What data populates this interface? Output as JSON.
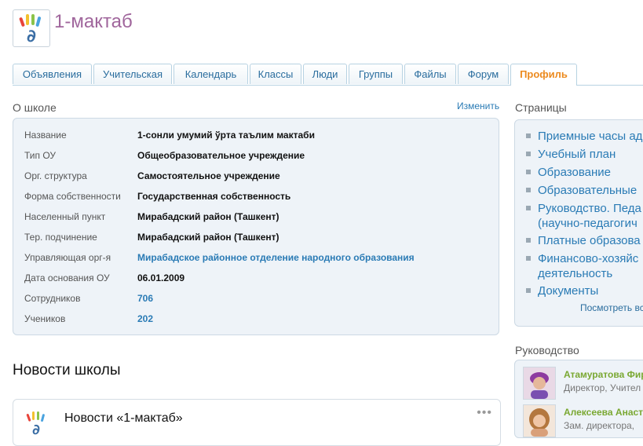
{
  "header": {
    "title": "1-мактаб",
    "logo": "hand-logo"
  },
  "tabs": [
    {
      "label": "Объявления"
    },
    {
      "label": "Учительская"
    },
    {
      "label": "Календарь"
    },
    {
      "label": "Классы"
    },
    {
      "label": "Люди"
    },
    {
      "label": "Группы"
    },
    {
      "label": "Файлы"
    },
    {
      "label": "Форум"
    },
    {
      "label": "Профиль",
      "active": true
    }
  ],
  "about": {
    "heading": "О школе",
    "edit_label": "Изменить",
    "rows": [
      {
        "key": "Название",
        "value": "1-сонли умумий ўрта таълим мактаби"
      },
      {
        "key": "Тип ОУ",
        "value": "Общеобразовательное учреждение"
      },
      {
        "key": "Орг. структура",
        "value": "Самостоятельное учреждение"
      },
      {
        "key": "Форма собственности",
        "value": "Государственная собственность"
      },
      {
        "key": "Населенный пункт",
        "value": "Мирабадский район (Ташкент)"
      },
      {
        "key": "Тер. подчинение",
        "value": "Мирабадский район (Ташкент)"
      },
      {
        "key": "Управляющая орг-я",
        "value": "Мирабадское районное отделение народного образования",
        "link": true
      },
      {
        "key": "Дата основания ОУ",
        "value": "06.01.2009"
      },
      {
        "key": "Сотрудников",
        "value": "706",
        "link": true
      },
      {
        "key": "Учеников",
        "value": "202",
        "link": true
      }
    ]
  },
  "news": {
    "heading": "Новости школы",
    "card_title": "Новости «1-мактаб»",
    "menu_icon": "more-dots-icon"
  },
  "pages": {
    "heading": "Страницы",
    "items": [
      {
        "lines": [
          "Приемные часы ад"
        ]
      },
      {
        "lines": [
          "Учебный план"
        ]
      },
      {
        "lines": [
          "Образование"
        ]
      },
      {
        "lines": [
          "Образовательные"
        ]
      },
      {
        "lines": [
          "Руководство. Педа",
          "(научно-педагогич"
        ]
      },
      {
        "lines": [
          "Платные образова"
        ]
      },
      {
        "lines": [
          "Финансово-хозяйс",
          "деятельность"
        ]
      },
      {
        "lines": [
          "Документы"
        ]
      }
    ],
    "see_all": "Посмотреть вс"
  },
  "leadership": {
    "heading": "Руководство",
    "people": [
      {
        "name": "Атамуратова Фир",
        "role": "Директор, Учител"
      },
      {
        "name": "Алексеева Анаст",
        "role": "Зам. директора, "
      }
    ]
  },
  "colors": {
    "accent": "#2a7bb5",
    "title": "#a0669c",
    "active_tab": "#ec8a1e",
    "name_green": "#7aa832"
  }
}
